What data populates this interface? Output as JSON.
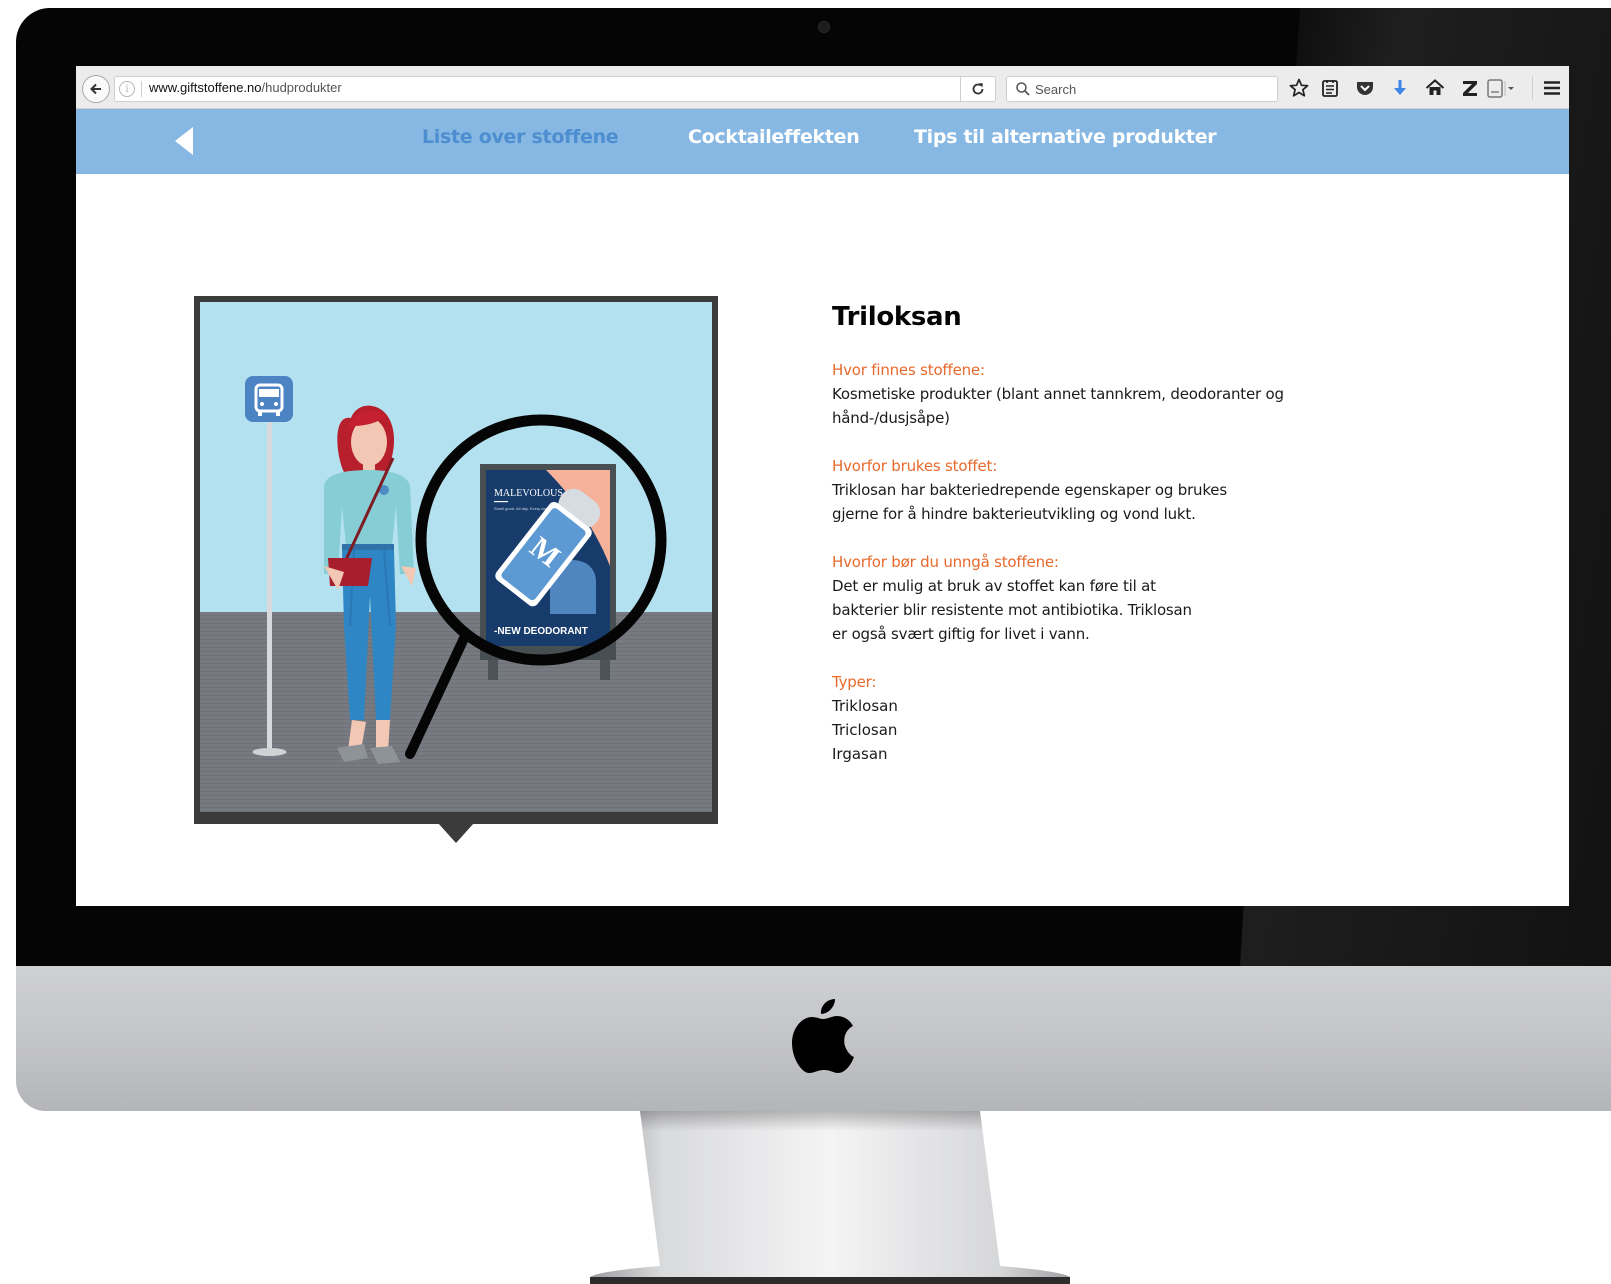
{
  "browser": {
    "url_domain": "www.giftstoffene.no",
    "url_path": "/hudprodukter",
    "search_placeholder": "Search",
    "toolbar_icons": [
      "back-icon",
      "info-icon",
      "reload-icon",
      "search-icon",
      "bookmark-star-icon",
      "reading-list-icon",
      "pocket-icon",
      "download-icon",
      "home-icon",
      "zotero-icon",
      "page-icon",
      "menu-icon"
    ]
  },
  "nav": {
    "items": [
      {
        "label": "Liste over stoffene",
        "active": true
      },
      {
        "label": "Cocktaileffekten",
        "active": false
      },
      {
        "label": "Tips til alternative produkter",
        "active": false
      }
    ],
    "active_color": "#4d8ed1",
    "bar_color": "#87b8e3"
  },
  "illustration": {
    "poster_brand": "MALEVOLOUS",
    "poster_tagline": "Smell good. All day. Every day.",
    "poster_logo_letter": "M",
    "poster_caption": "-NEW DEODORANT"
  },
  "substance": {
    "title": "Triloksan",
    "sections": [
      {
        "heading": "Hvor finnes stoffene:",
        "body": "Kosmetiske produkter (blant annet tannkrem, deodoranter og\nhånd-/dusjsåpe)"
      },
      {
        "heading": "Hvorfor brukes stoffet:",
        "body": "Triklosan har bakteriedrepende egenskaper og brukes\ngjerne for å hindre bakterieutvikling og vond lukt."
      },
      {
        "heading": "Hvorfor bør du unngå stoffene:",
        "body": "Det er mulig at bruk av stoffet kan føre til at\nbakterier blir resistente mot antibiotika. Triklosan\ner også svært giftig for livet i vann."
      }
    ],
    "types_heading": "Typer:",
    "types": [
      "Triklosan",
      "Triclosan",
      "Irgasan"
    ],
    "heading_color": "#e8692b"
  }
}
